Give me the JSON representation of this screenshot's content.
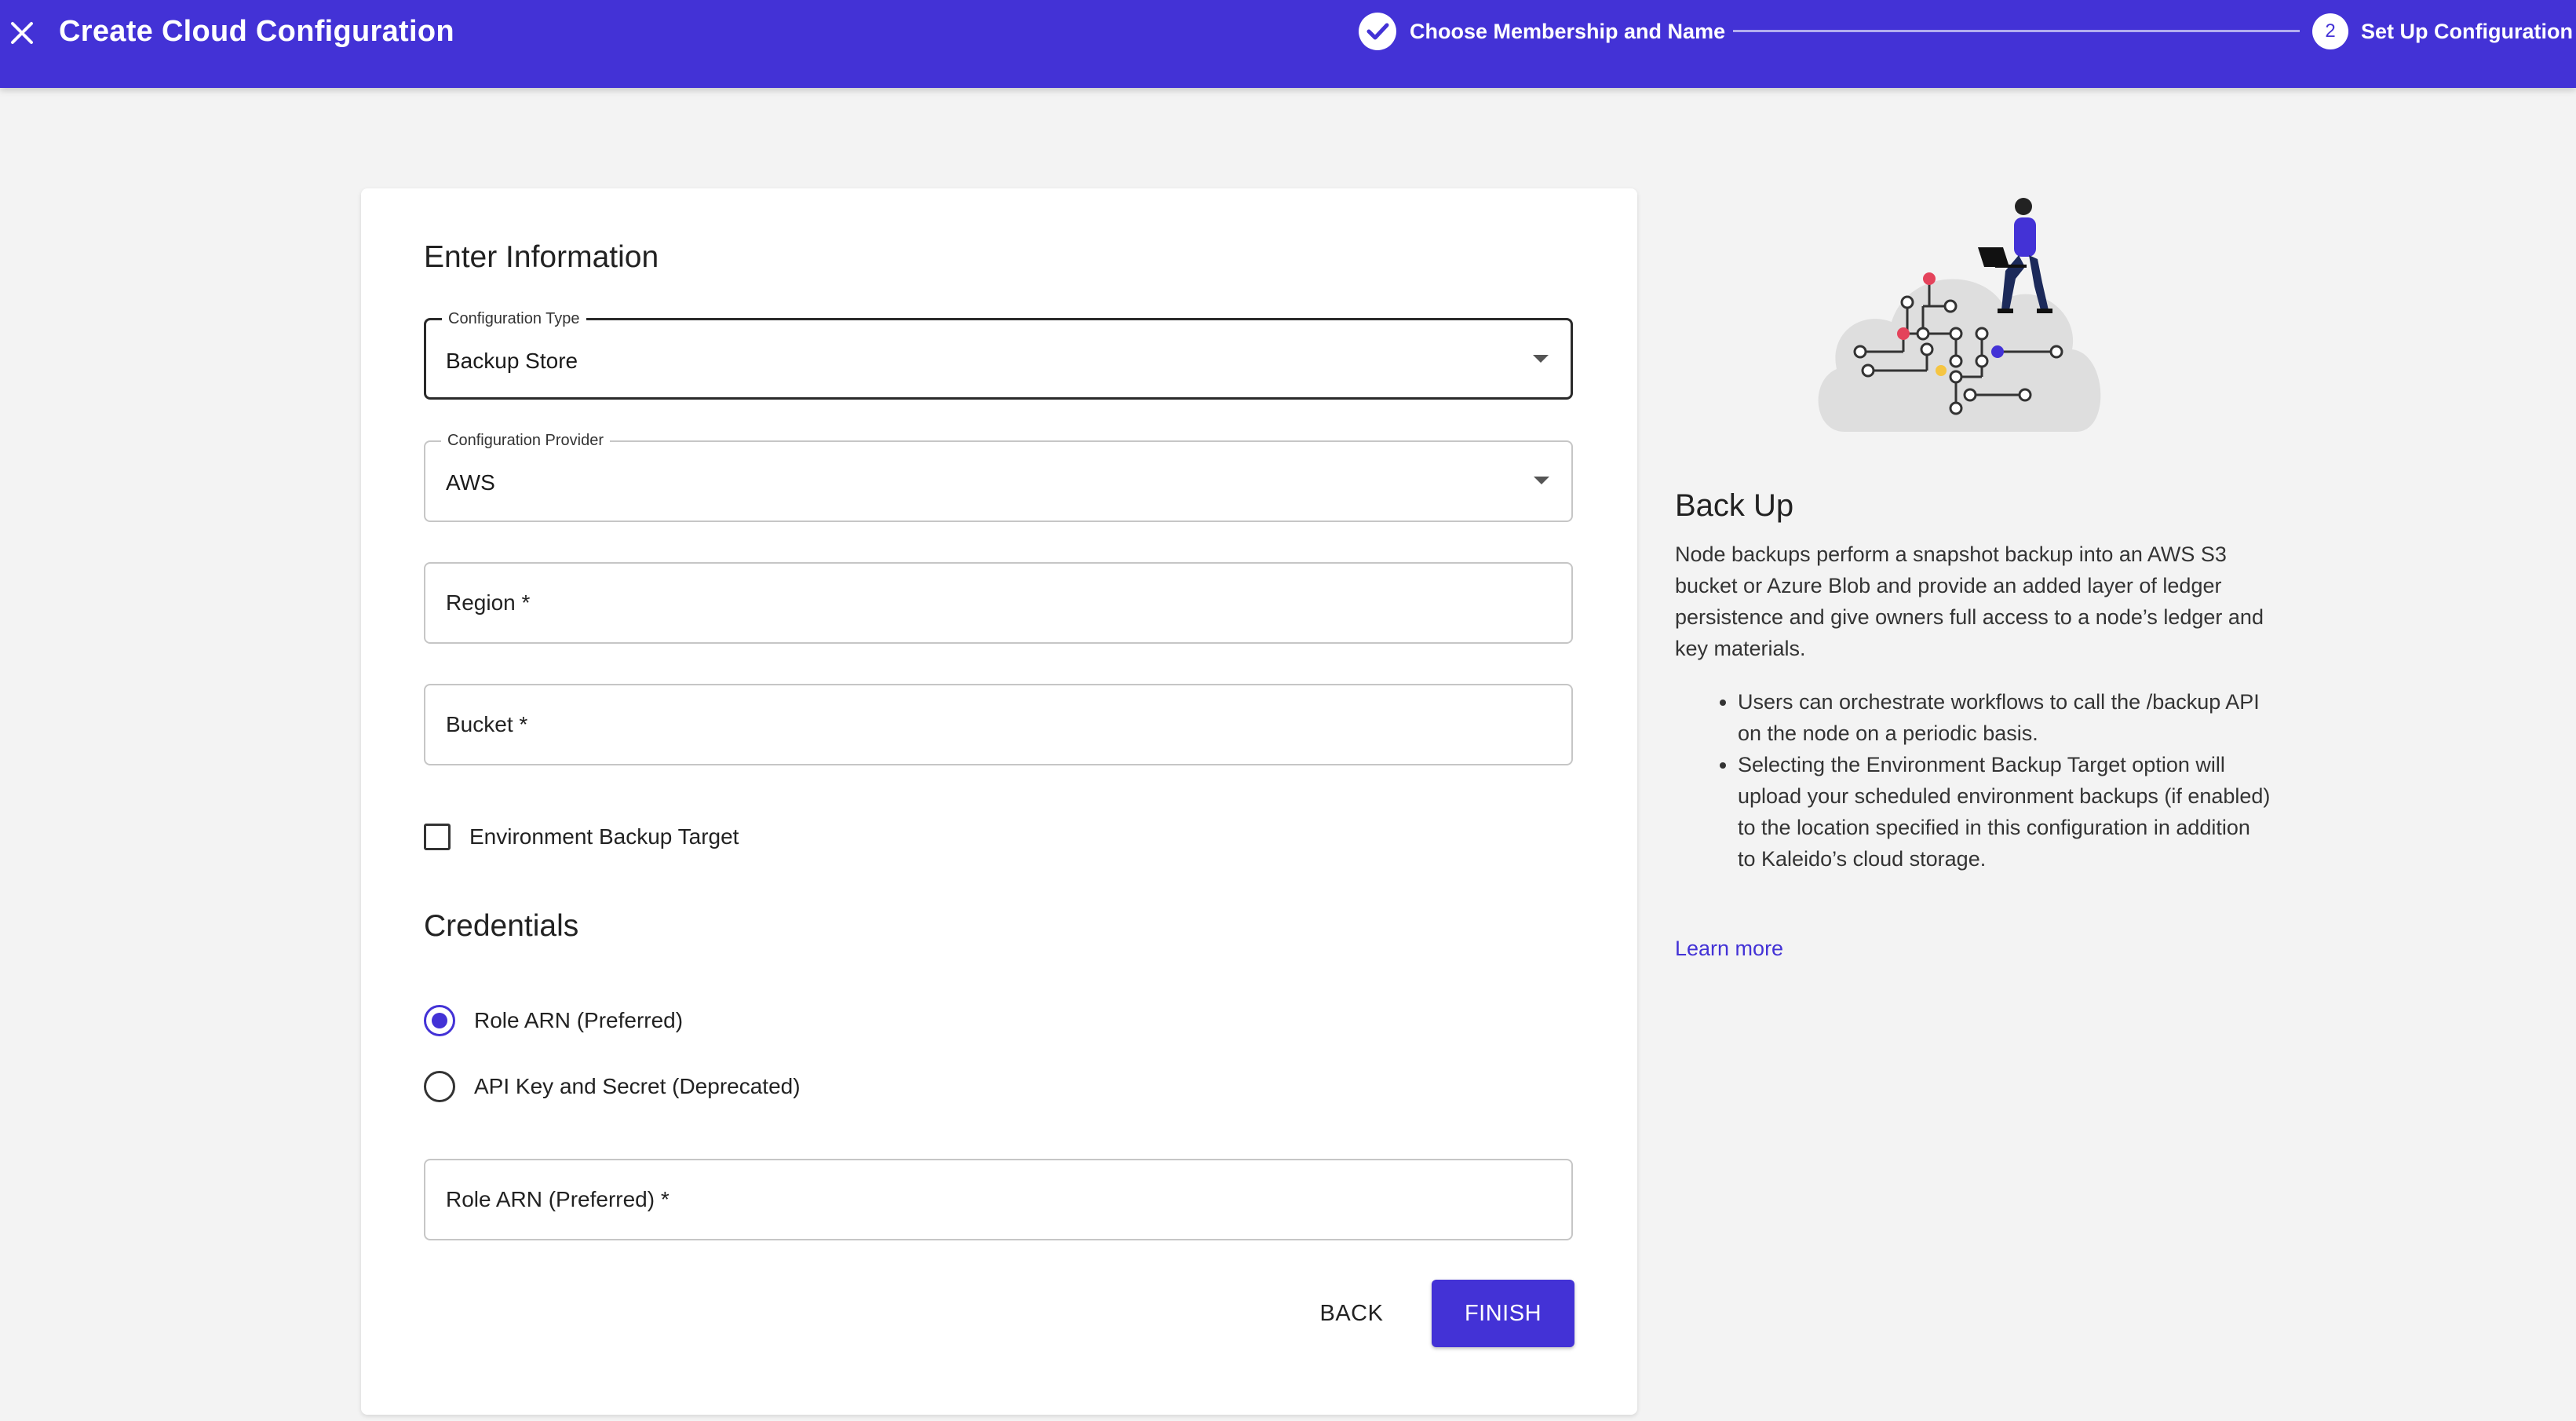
{
  "header": {
    "title": "Create Cloud Configuration",
    "steps": [
      {
        "label": "Choose Membership and Name",
        "state": "complete"
      },
      {
        "number": "2",
        "label": "Set Up Configuration",
        "state": "active"
      }
    ]
  },
  "form": {
    "section_title": "Enter Information",
    "configuration_type": {
      "label": "Configuration Type",
      "value": "Backup Store"
    },
    "configuration_provider": {
      "label": "Configuration Provider",
      "value": "AWS"
    },
    "region": {
      "placeholder": "Region *",
      "value": ""
    },
    "bucket": {
      "placeholder": "Bucket *",
      "value": ""
    },
    "environment_backup": {
      "label": "Environment Backup Target",
      "checked": false
    },
    "credentials": {
      "title": "Credentials",
      "options": [
        {
          "label": "Role ARN (Preferred)",
          "selected": true
        },
        {
          "label": "API Key and Secret (Deprecated)",
          "selected": false
        }
      ]
    },
    "role_arn": {
      "placeholder": "Role ARN (Preferred) *",
      "value": ""
    },
    "back_label": "BACK",
    "finish_label": "FINISH"
  },
  "info": {
    "title": "Back Up",
    "body": "Node backups perform a snapshot backup into an AWS S3 bucket or Azure Blob and provide an added layer of ledger persistence and give owners full access to a node’s ledger and key materials.",
    "bullets": [
      "Users can orchestrate workflows to call the /backup API on the node on a periodic basis.",
      "Selecting the Environment Backup Target option will upload your scheduled environment backups (if enabled) to the location specified in this configuration in addition to Kaleido’s cloud storage."
    ],
    "link_label": "Learn more"
  },
  "colors": {
    "primary": "#4332d6",
    "background": "#f3f3f3",
    "accent_red": "#e4435b",
    "accent_yellow": "#f5c542"
  },
  "icons": {
    "close": "close-icon",
    "step_done": "check-circle-icon",
    "dropdown": "caret-down-icon"
  }
}
